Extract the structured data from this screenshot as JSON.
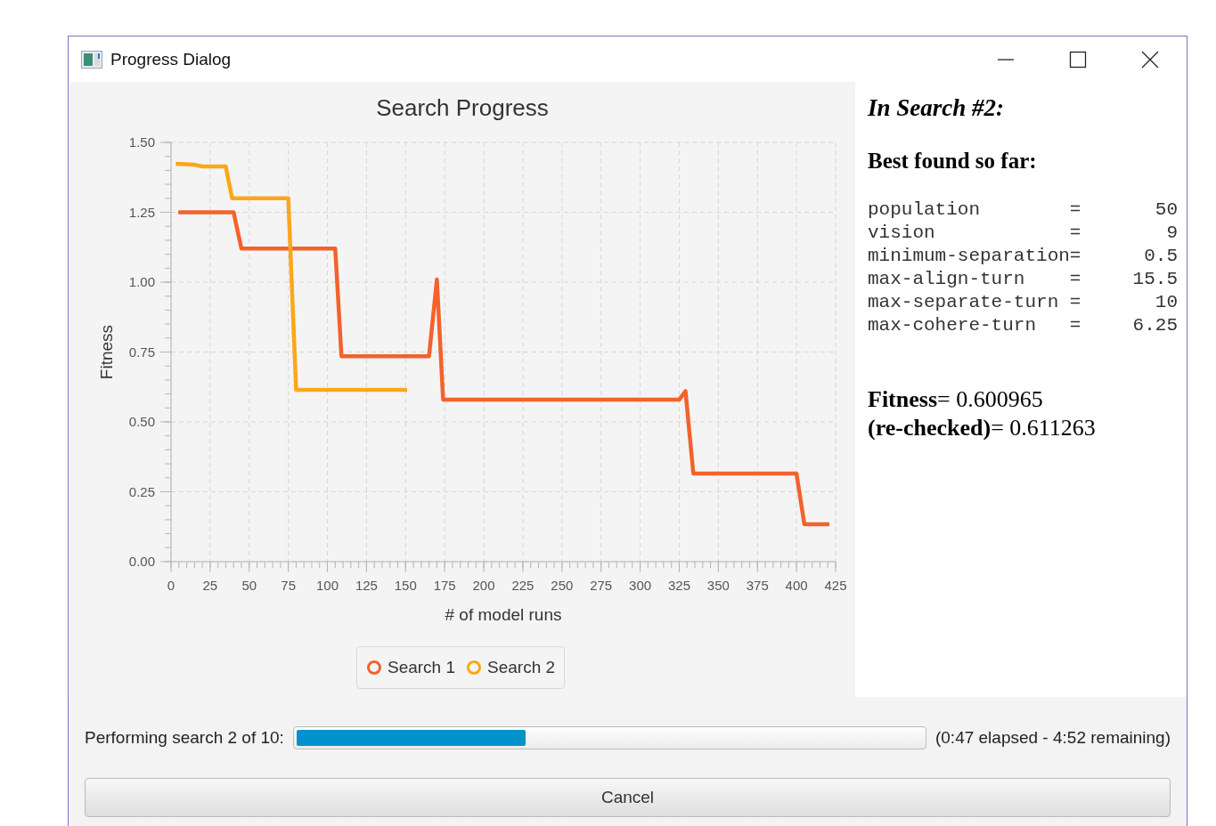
{
  "window": {
    "title": "Progress Dialog"
  },
  "chart": {
    "chart_data": {
      "type": "line",
      "grid": true,
      "legend": true,
      "title": "Search Progress",
      "xlabel": "# of model runs",
      "ylabel": "Fitness",
      "xlim": [
        0,
        425
      ],
      "ylim": [
        0,
        1.5
      ],
      "xticks": [
        0,
        25,
        50,
        75,
        100,
        125,
        150,
        175,
        200,
        225,
        250,
        275,
        300,
        325,
        350,
        375,
        400,
        425
      ],
      "yticks": [
        {
          "value": 0,
          "label": "0.00"
        },
        {
          "value": 0.25,
          "label": "0.25"
        },
        {
          "value": 0.5,
          "label": "0.50"
        },
        {
          "value": 0.75,
          "label": "0.75"
        },
        {
          "value": 1,
          "label": "1.00"
        },
        {
          "value": 1.25,
          "label": "1.25"
        },
        {
          "value": 1.5,
          "label": "1.50"
        }
      ],
      "series": [
        {
          "name": "Search 1",
          "color": "#f3622d",
          "x": [
            4.6,
            40,
            45,
            105,
            109,
            165,
            170,
            174,
            325,
            329,
            334,
            400,
            405,
            421
          ],
          "values": [
            1.25,
            1.25,
            1.12,
            1.12,
            0.735,
            0.735,
            1.01,
            0.58,
            0.58,
            0.61,
            0.315,
            0.315,
            0.134,
            0.134
          ]
        },
        {
          "name": "Search 2",
          "color": "#fba71b",
          "x": [
            3,
            15,
            20,
            35,
            39,
            75,
            80,
            151
          ],
          "values": [
            1.424,
            1.42,
            1.414,
            1.414,
            1.3,
            1.3,
            0.615,
            0.615
          ]
        }
      ]
    }
  },
  "details": {
    "heading": "In Search #2:",
    "subheading": "Best found so far:",
    "parameters": [
      {
        "name": "population",
        "sep": "=",
        "value": "50"
      },
      {
        "name": "vision",
        "sep": "=",
        "value": "9"
      },
      {
        "name": "minimum-separation",
        "sep": "=",
        "value": "0.5"
      },
      {
        "name": "max-align-turn",
        "sep": "=",
        "value": "15.5"
      },
      {
        "name": "max-separate-turn",
        "sep": "=",
        "value": "10"
      },
      {
        "name": "max-cohere-turn",
        "sep": "=",
        "value": "6.25"
      }
    ],
    "results": [
      "**Fitness**= 0.600965",
      "**(re-checked)**= 0.611263"
    ]
  },
  "progress": {
    "label": "Performing search 2 of 10:",
    "level": 0.365,
    "time": "(0:47 elapsed - 4:52 remaining)"
  },
  "buttons": [
    "Cancel"
  ]
}
